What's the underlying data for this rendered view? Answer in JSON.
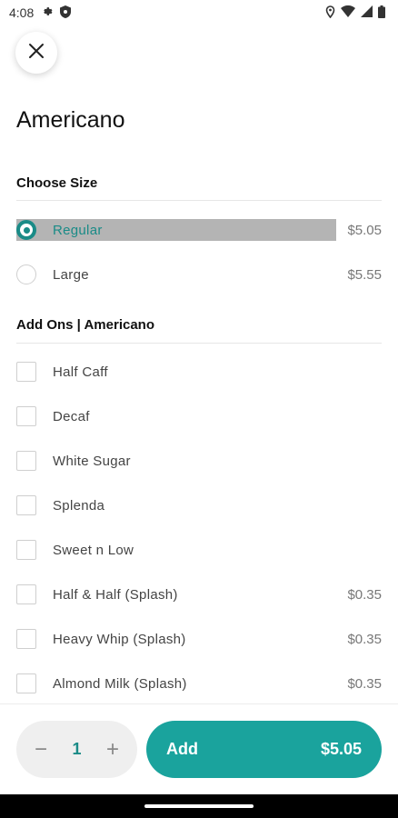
{
  "status": {
    "time": "4:08"
  },
  "product": {
    "title": "Americano"
  },
  "size_section": {
    "title": "Choose Size",
    "options": [
      {
        "label": "Regular",
        "price": "$5.05",
        "selected": true
      },
      {
        "label": "Large",
        "price": "$5.55",
        "selected": false
      }
    ]
  },
  "addons_section": {
    "title": "Add Ons | Americano",
    "options": [
      {
        "label": "Half Caff",
        "price": ""
      },
      {
        "label": "Decaf",
        "price": ""
      },
      {
        "label": "White Sugar",
        "price": ""
      },
      {
        "label": "Splenda",
        "price": ""
      },
      {
        "label": "Sweet n Low",
        "price": ""
      },
      {
        "label": "Half & Half (Splash)",
        "price": "$0.35"
      },
      {
        "label": "Heavy Whip (Splash)",
        "price": "$0.35"
      },
      {
        "label": "Almond Milk (Splash)",
        "price": "$0.35"
      }
    ]
  },
  "bottom": {
    "quantity": "1",
    "minus": "−",
    "plus": "+",
    "add_label": "Add",
    "add_price": "$5.05"
  },
  "colors": {
    "accent": "#1aa39d",
    "selected": "#1a8b87"
  }
}
